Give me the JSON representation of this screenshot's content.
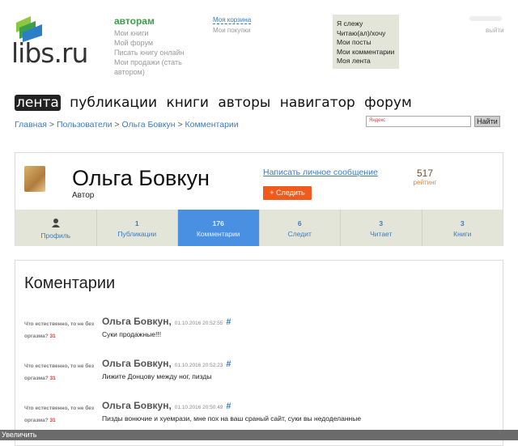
{
  "logo": {
    "text": "libs.ru",
    "colors": [
      "#8dc63f",
      "#3aa14a",
      "#2a7fc8"
    ]
  },
  "authors_menu": {
    "title": "авторам",
    "items": [
      "Мои книги",
      "Мой форум",
      "Писать книгу онлайн",
      "Мои продажи (стать автором)"
    ]
  },
  "cart": {
    "cart": "Моя корзина",
    "purchases": "Мои покупки"
  },
  "my_menu": [
    "Я слежу",
    "Читаю(ал)/хочу",
    "Мои посты",
    "Мои комментарии",
    "Моя лента"
  ],
  "logout": "выйти",
  "nav": [
    "лента",
    "публикации",
    "книги",
    "авторы",
    "навигатор",
    "форум"
  ],
  "breadcrumb": [
    "Главная",
    "Пользователи",
    "Ольга Бовкун",
    "Комментарии"
  ],
  "search": {
    "placeholder": "Яндекс",
    "button": "Найти"
  },
  "profile": {
    "name": "Ольга Бовкун",
    "role": "Автор",
    "message_link": "Написать личное сообщение",
    "follow": "+ Следить",
    "rating_value": "517",
    "rating_label": "рейтинг"
  },
  "tabs": [
    {
      "count": "",
      "label": "Профиль",
      "icon": "user-icon"
    },
    {
      "count": "1",
      "label": "Публикации"
    },
    {
      "count": "176",
      "label": "Комментарии",
      "active": true
    },
    {
      "count": "6",
      "label": "Следит"
    },
    {
      "count": "3",
      "label": "Читает"
    },
    {
      "count": "3",
      "label": "Книги"
    }
  ],
  "comments_title": "Коментарии",
  "comments": [
    {
      "source": "Что естественно, то не без оргазма?",
      "source_count": "31",
      "author": "Ольга Бовкун,",
      "date": "01.10.2016 20:52:55",
      "hash": "#",
      "text": "Суки продажные!!!"
    },
    {
      "source": "Что естественно, то не без оргазма?",
      "source_count": "31",
      "author": "Ольга Бовкун,",
      "date": "01.10.2016 20:52:23",
      "hash": "#",
      "text": "Лижите Донцову между ног, пизды"
    },
    {
      "source": "Что естественно, то не без оргазма?",
      "source_count": "31",
      "author": "Ольга Бовкун,",
      "date": "01.10.2016 20:50:49",
      "hash": "#",
      "text": "Пизды вонючие и хуемрази, мне пох на ваш сраный сайт, суки вы недоделанные"
    }
  ],
  "bottom_bar": "Увеличить",
  "colors": {
    "accent": "#4a90e2",
    "follow": "#f15a1d",
    "link": "#3a7bc8"
  }
}
